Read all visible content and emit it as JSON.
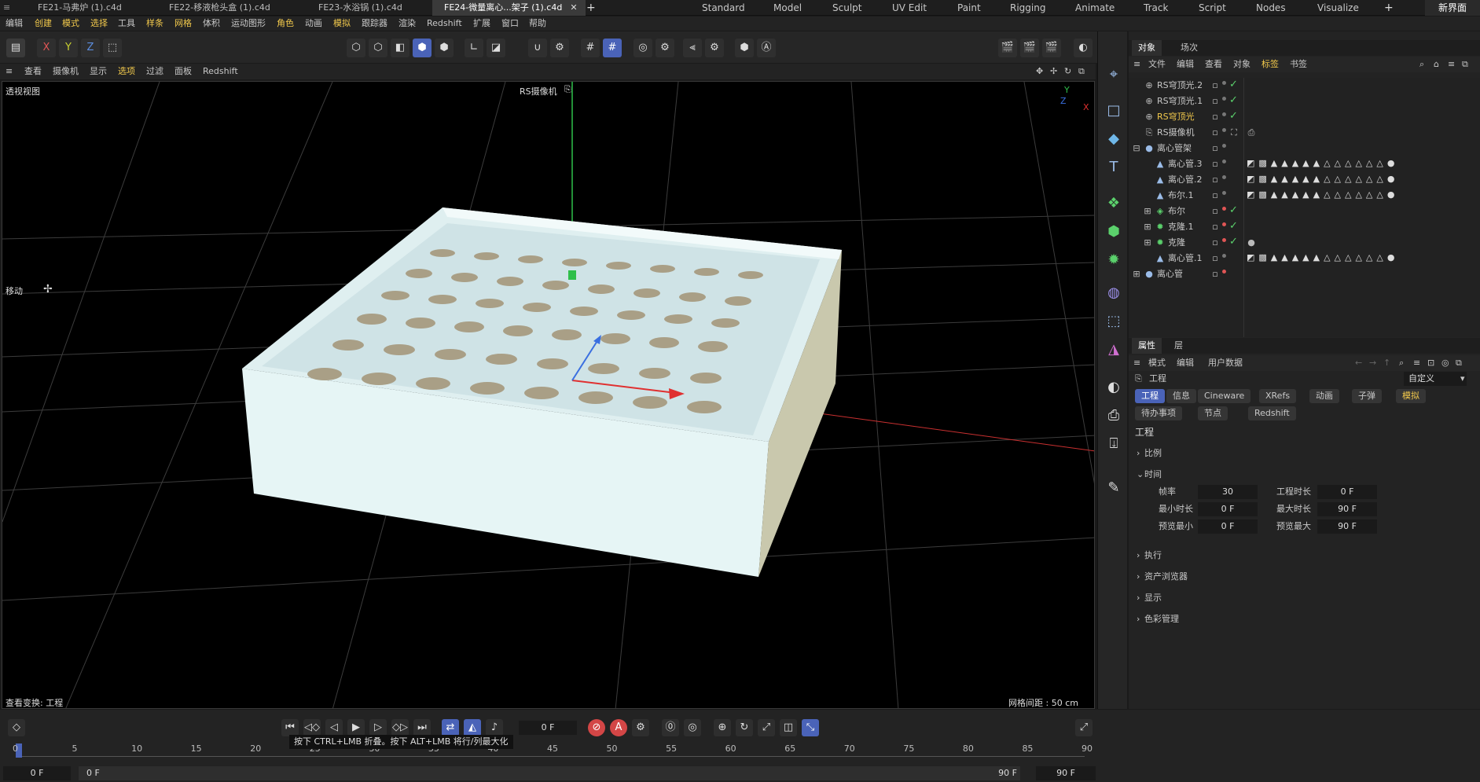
{
  "file_tabs": [
    {
      "label": "FE21-马弗炉 (1).c4d",
      "active": false
    },
    {
      "label": "FE22-移液枪头盒 (1).c4d",
      "active": false
    },
    {
      "label": "FE23-水浴锅 (1).c4d",
      "active": false
    },
    {
      "label": "FE24-微量离心...架子 (1).c4d",
      "active": true
    }
  ],
  "workspace_tabs": [
    "Standard",
    "Model",
    "Sculpt",
    "UV Edit",
    "Paint",
    "Rigging",
    "Animate",
    "Track",
    "Script",
    "Nodes",
    "Visualize"
  ],
  "workspace_new": "新界面",
  "menus": [
    "编辑",
    "创建",
    "模式",
    "选择",
    "工具",
    "样条",
    "网格",
    "体积",
    "运动图形",
    "角色",
    "动画",
    "模拟",
    "跟踪器",
    "渲染",
    "Redshift",
    "扩展",
    "窗口",
    "帮助"
  ],
  "viewport_menu": [
    "查看",
    "摄像机",
    "显示",
    "选项",
    "过滤",
    "面板",
    "Redshift"
  ],
  "viewport": {
    "view_name": "透视视图",
    "camera": "RS摄像机",
    "tool": "移动",
    "status": "查看变换: 工程",
    "grid_spacing": "网格间距 : 50 cm",
    "axis_y": "Y",
    "axis_x": "X",
    "axis_z": "Z"
  },
  "object_tabs": [
    "对象",
    "场次"
  ],
  "object_menu": [
    "文件",
    "编辑",
    "查看",
    "对象",
    "标签",
    "书签"
  ],
  "objects": [
    {
      "name": "RS穹顶光.2",
      "check": true
    },
    {
      "name": "RS穹顶光.1",
      "check": true
    },
    {
      "name": "RS穹顶光",
      "check": true,
      "selected": true
    },
    {
      "name": "RS摄像机",
      "check": false
    },
    {
      "name": "离心管架",
      "check": false
    },
    {
      "name": "离心管.3",
      "check": false
    },
    {
      "name": "离心管.2",
      "check": false
    },
    {
      "name": "布尔.1",
      "check": false
    },
    {
      "name": "布尔",
      "check": true
    },
    {
      "name": "克隆.1",
      "check": true
    },
    {
      "name": "克隆",
      "check": true
    },
    {
      "name": "离心管.1",
      "check": false
    },
    {
      "name": "离心管",
      "check": false
    }
  ],
  "attr_tabs": [
    "属性",
    "层"
  ],
  "attr_menu": [
    "模式",
    "编辑",
    "用户数据"
  ],
  "attr": {
    "title": "工程",
    "preset": "自定义",
    "buttons": [
      "工程",
      "信息",
      "Cineware",
      "XRefs",
      "动画",
      "子弹",
      "模拟",
      "待办事项",
      "节点",
      "Redshift"
    ],
    "heading": "工程",
    "sections": [
      "比例",
      "时间",
      "执行",
      "资产浏览器",
      "显示",
      "色彩管理"
    ],
    "fields": [
      {
        "label": "帧率",
        "value": "30"
      },
      {
        "label": "工程时长",
        "value": "0 F"
      },
      {
        "label": "最小时长",
        "value": "0 F"
      },
      {
        "label": "最大时长",
        "value": "90 F"
      },
      {
        "label": "预览最小",
        "value": "0 F"
      },
      {
        "label": "预览最大",
        "value": "90 F"
      }
    ]
  },
  "timeline": {
    "current_frame": "0 F",
    "tooltip": "按下 CTRL+LMB 折叠。按下 ALT+LMB 将行/列最大化",
    "ticks": [
      "0",
      "5",
      "10",
      "15",
      "20",
      "25",
      "30",
      "35",
      "40",
      "45",
      "50",
      "55",
      "60",
      "65",
      "70",
      "75",
      "80",
      "85",
      "90"
    ],
    "start": "0 F",
    "range_start": "0 F",
    "range_end": "90 F",
    "end": "90 F"
  }
}
